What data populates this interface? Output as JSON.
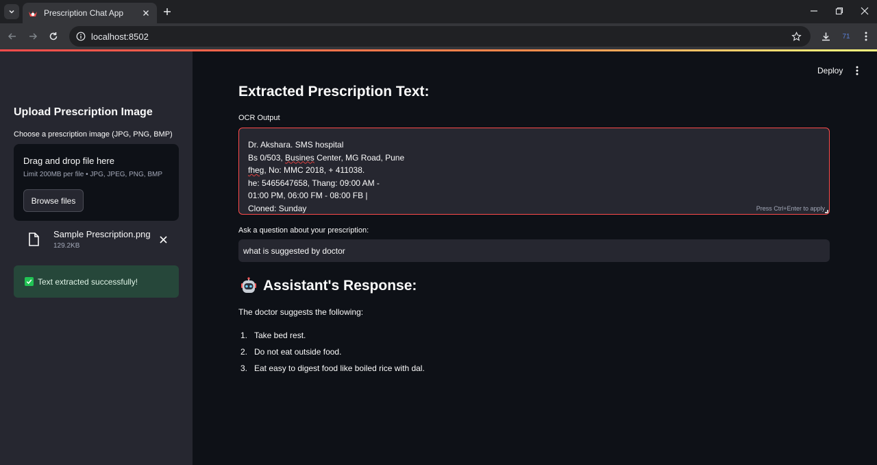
{
  "browser": {
    "tab_title": "Prescription Chat App",
    "url": "localhost:8502",
    "extension_badge": "71"
  },
  "sidebar": {
    "title": "Upload Prescription Image",
    "uploader_label": "Choose a prescription image (JPG, PNG, BMP)",
    "dropzone_main": "Drag and drop file here",
    "dropzone_sub": "Limit 200MB per file • JPG, JPEG, PNG, BMP",
    "browse_label": "Browse files",
    "file_name": "Sample Prescription.png",
    "file_size": "129.2KB",
    "success_message": "Text extracted successfully!"
  },
  "header": {
    "deploy_label": "Deploy"
  },
  "main": {
    "extracted_title": "Extracted Prescription Text:",
    "ocr_label": "OCR Output",
    "ocr_lines": [
      "Dr. Akshara. SMS hospital",
      "Bs 0/503, Busines Center, MG Road, Pune",
      "fheg, No: MMC 2018, + 411038.",
      "he: 5465647658, Thang: 09:00 AM -",
      "01:00 PM, 06:00 FM - 08:00 FB |",
      "Cloned: Sunday"
    ],
    "ocr_hint": "Press Ctrl+Enter to apply",
    "question_label": "Ask a question about your prescription:",
    "question_value": "what is suggested by doctor",
    "response_title": "Assistant's Response:",
    "response_intro": "The doctor suggests the following:",
    "response_items": [
      {
        "num": "1.",
        "text": "Take bed rest."
      },
      {
        "num": "2.",
        "text": "Do not eat outside food."
      },
      {
        "num": "3.",
        "text": "Eat easy to digest food like boiled rice with dal."
      }
    ]
  },
  "colors": {
    "accent": "#ff4b4b",
    "success_bg": "#26473a",
    "success_check": "#21c354",
    "sidebar_bg": "#262730",
    "main_bg": "#0e1117"
  }
}
